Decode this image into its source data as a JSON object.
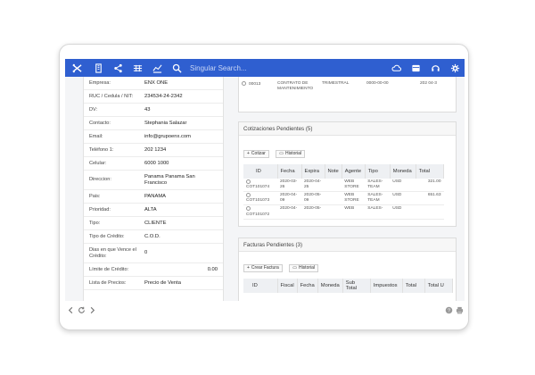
{
  "topbar": {
    "search_placeholder": "Singular Search...",
    "icons": [
      "building-icon",
      "share-icon",
      "list-icon",
      "chart-icon",
      "search-icon"
    ],
    "right_icons": [
      "cloud-icon",
      "inbox-icon",
      "headset-icon",
      "gear-icon"
    ]
  },
  "client": {
    "rows": [
      {
        "label": "Empresa:",
        "value": "ENX ONE"
      },
      {
        "label": "RUC / Cedula / NIT:",
        "value": "234534-24-2342"
      },
      {
        "label": "DV:",
        "value": "43"
      },
      {
        "label": "Contacto:",
        "value": "Stephania Salazar"
      },
      {
        "label": "Email:",
        "value": "info@grupoenx.com"
      },
      {
        "label": "Teléfono 1:",
        "value": "202 1234"
      },
      {
        "label": "Celular:",
        "value": "6000 1000"
      },
      {
        "label": "Direccion:",
        "value": "Panama Panama San Francisco"
      },
      {
        "label": "Pais:",
        "value": "PANAMA"
      },
      {
        "label": "Prioridad:",
        "value": "ALTA"
      },
      {
        "label": "Tipo:",
        "value": "CLIENTE"
      },
      {
        "label": "Tipo de Crédito:",
        "value": "C.O.D."
      },
      {
        "label": "Dias en que Vence el Crédito:",
        "value": "0"
      },
      {
        "label": "Límite de Crédito:",
        "value": "0.00"
      },
      {
        "label": "Lista de Precios:",
        "value": "Precio de Venta"
      }
    ]
  },
  "contracts": {
    "row": {
      "id": "00013",
      "desc": "CONTRATO DE MANTENIMIENTO",
      "period": "TRIMESTRAL",
      "date": "0000-00-00",
      "date2": "202 04-3"
    }
  },
  "quotes": {
    "title": "Cotizaciones Pendientes (5)",
    "btn_new": "Cotizar",
    "btn_history": "Historial",
    "columns": [
      "ID",
      "Fecha",
      "Expira",
      "Note",
      "Agente",
      "Tipo",
      "Moneda",
      "Total"
    ],
    "rows": [
      {
        "id": "COT101074",
        "fecha": "2020-03-26",
        "expira": "2020-04-25",
        "note": "",
        "agente": "WEB STORE",
        "tipo": "SALES-TEAM",
        "moneda": "USD",
        "total": "321.00"
      },
      {
        "id": "COT101073",
        "fecha": "2020-04-09",
        "expira": "2020-05-09",
        "note": "",
        "agente": "WEB STORE",
        "tipo": "SALES-TEAM",
        "moneda": "USD",
        "total": "651.63"
      },
      {
        "id": "COT101072",
        "fecha": "2020-04-",
        "expira": "2020-05-",
        "note": "",
        "agente": "WEB",
        "tipo": "SALES-",
        "moneda": "USD",
        "total": ""
      }
    ]
  },
  "invoices": {
    "title": "Facturas Pendientes (3)",
    "btn_new": "Crear Factura",
    "btn_history": "Historial",
    "columns": [
      "ID",
      "Fiscal",
      "Fecha",
      "Moneda",
      "Sub Total",
      "Impuestos",
      "Total",
      "Total U"
    ]
  },
  "colors": {
    "topbar": "#2f5fd0"
  }
}
